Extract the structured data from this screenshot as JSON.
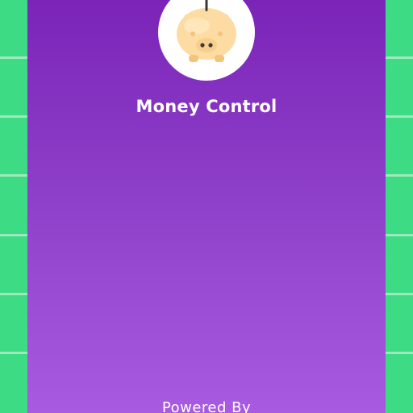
{
  "app": {
    "title": "Money Control",
    "footer": "Powered By"
  },
  "logo": {
    "icon": "piggy-bank-icon"
  },
  "colors": {
    "side_tiles": "#3ddc84",
    "tile_lines": "#9fe8be",
    "gradient_top": "#7b24b8",
    "gradient_bottom": "#a85be0",
    "title_text": "#ffffff",
    "piggy_body": "#fcdca3"
  }
}
